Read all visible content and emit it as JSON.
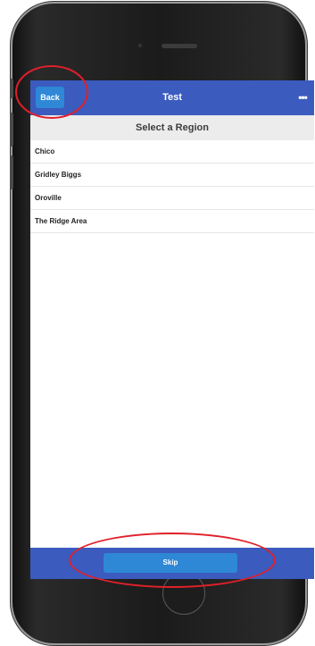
{
  "navbar": {
    "back_label": "Back",
    "title": "Test",
    "more_icon": "more-horizontal-icon",
    "color": "#3b5bbf"
  },
  "section": {
    "title": "Select a Region"
  },
  "regions": [
    {
      "label": "Chico"
    },
    {
      "label": "Gridley Biggs"
    },
    {
      "label": "Oroville"
    },
    {
      "label": "The Ridge Area"
    }
  ],
  "footer": {
    "skip_label": "Skip"
  },
  "colors": {
    "accent": "#2e88d6",
    "bar": "#3b5bbf",
    "annotation": "#e0202a"
  }
}
